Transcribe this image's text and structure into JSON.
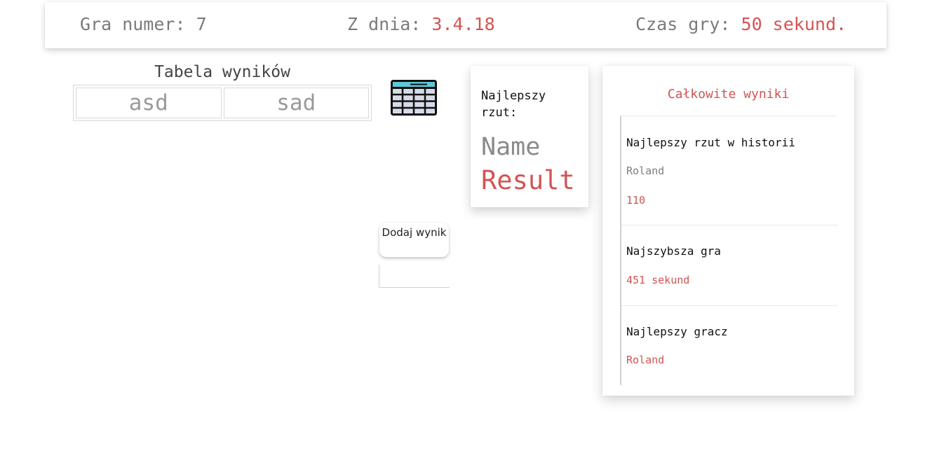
{
  "header": {
    "game_label": "Gra numer: 7",
    "date_label": "Z dnia:",
    "date_value": "3.4.18",
    "time_label": "Czas gry:",
    "time_value": "50 sekund."
  },
  "score_table": {
    "title": "Tabela wyników",
    "cells": [
      "asd",
      "sad"
    ]
  },
  "best_throw_card": {
    "label": "Najlepszy rzut:",
    "name": "Name",
    "result": "Result"
  },
  "add_button": {
    "label": "Dodaj wynik"
  },
  "totals": {
    "title": "Całkowite wyniki",
    "best_throw_history": {
      "heading": "Najlepszy rzut w historii",
      "player": "Roland",
      "value": "110"
    },
    "fastest_game": {
      "heading": "Najszybsza gra",
      "value": "451 sekund"
    },
    "best_player": {
      "heading": "Najlepszy gracz",
      "value": "Roland"
    }
  },
  "icons": {
    "table": "table-icon"
  },
  "colors": {
    "accent": "#d35454",
    "muted": "#7b7b7b",
    "icon_header": "#5ec8d6"
  }
}
